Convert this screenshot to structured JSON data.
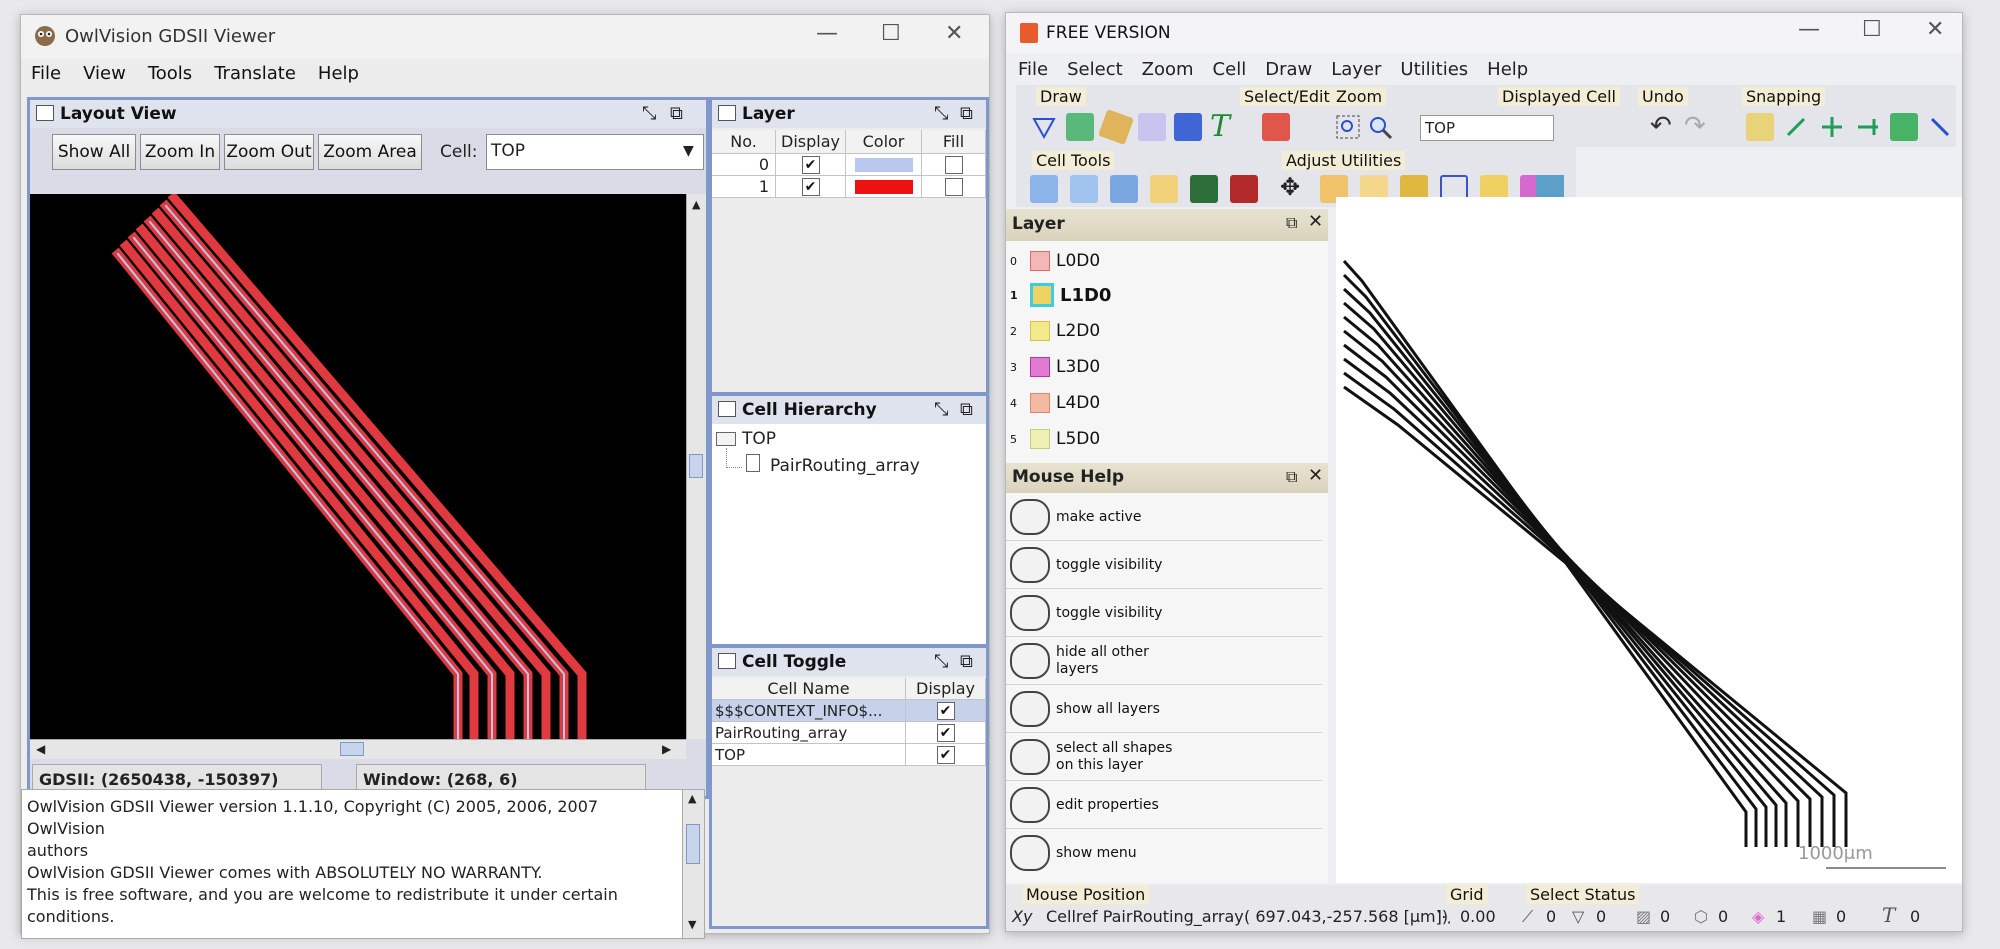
{
  "left_app": {
    "title": "OwlVision GDSII Viewer",
    "window_controls": {
      "minimize": "—",
      "maximize": "☐",
      "close": "✕"
    },
    "menu": [
      "File",
      "View",
      "Tools",
      "Translate",
      "Help"
    ],
    "layout_view": {
      "title": "Layout View",
      "buttons": [
        "Show All",
        "Zoom In",
        "Zoom Out",
        "Zoom Area"
      ],
      "cell_label": "Cell:",
      "cell_value": "TOP",
      "status_gdsii": "GDSII: (2650438, -150397)",
      "status_window": "Window: (268, 6)"
    },
    "layer_panel": {
      "title": "Layer",
      "columns": [
        "No.",
        "Display",
        "Color",
        "Fill"
      ],
      "rows": [
        {
          "no": "0",
          "display": "✔",
          "color": "#b9c8ee",
          "fill": ""
        },
        {
          "no": "1",
          "display": "✔",
          "color": "#ee1111",
          "fill": ""
        }
      ]
    },
    "cell_hierarchy": {
      "title": "Cell Hierarchy",
      "root": "TOP",
      "child": "PairRouting_array"
    },
    "cell_toggle": {
      "title": "Cell Toggle",
      "columns": [
        "Cell Name",
        "Display"
      ],
      "rows": [
        {
          "name": "$$$CONTEXT_INFO$...",
          "display": "✔"
        },
        {
          "name": "PairRouting_array",
          "display": "✔"
        },
        {
          "name": "TOP",
          "display": "✔"
        }
      ]
    },
    "console_lines": [
      "OwlVision GDSII Viewer version 1.1.10, Copyright (C) 2005, 2006, 2007 OwlVision",
      "authors",
      "OwlVision GDSII Viewer comes with ABSOLUTELY NO WARRANTY.",
      "This is free software, and you are welcome to redistribute it under certain",
      "conditions."
    ]
  },
  "right_app": {
    "title": "FREE VERSION",
    "menu": [
      "File",
      "Select",
      "Zoom",
      "Cell",
      "Draw",
      "Layer",
      "Utilities",
      "Help"
    ],
    "toolbar_groups": [
      "Draw",
      "Select/Edit",
      "Zoom",
      "Displayed Cell",
      "Undo",
      "Snapping",
      "Cell Tools",
      "Adjust Utilities"
    ],
    "displayed_cell": "TOP",
    "layer_panel_title": "Layer",
    "layers": [
      {
        "num": "0",
        "name": "L0D0",
        "color": "#f3b7b7",
        "active": false
      },
      {
        "num": "1",
        "name": "L1D0",
        "color": "#f0d264",
        "active": true
      },
      {
        "num": "2",
        "name": "L2D0",
        "color": "#f3e98a",
        "active": false
      },
      {
        "num": "3",
        "name": "L3D0",
        "color": "#e07ad3",
        "active": false
      },
      {
        "num": "4",
        "name": "L4D0",
        "color": "#f3b9a3",
        "active": false
      },
      {
        "num": "5",
        "name": "L5D0",
        "color": "#eef0b6",
        "active": false
      }
    ],
    "mouse_help_title": "Mouse Help",
    "mouse_help": [
      "make active",
      "toggle visibility",
      "toggle visibility",
      "hide all other layers",
      "show all layers",
      "select all shapes on this layer",
      "edit properties",
      "show menu"
    ],
    "scale_label": "1000μm",
    "status": {
      "mouse_position_label": "Mouse Position",
      "cellref": "Cellref PairRouting_array",
      "coords": "( 697.043,-257.568 [μm])",
      "grid_label": "Grid",
      "grid_value": "0.00",
      "select_status_label": "Select Status",
      "counts": [
        "0",
        "0",
        "0",
        "0",
        "1",
        "0",
        "0"
      ]
    }
  }
}
